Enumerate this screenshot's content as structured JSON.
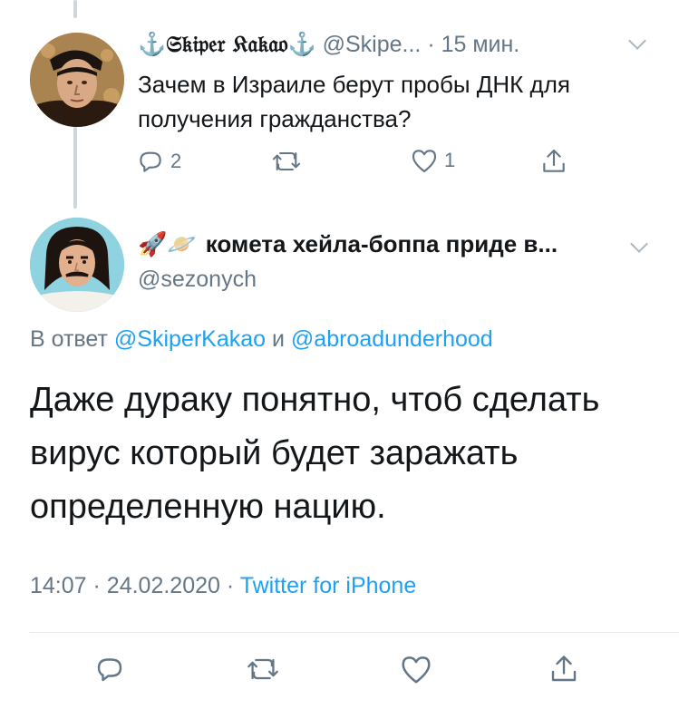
{
  "tweet1": {
    "display_name": "⚓𝔖𝔨𝔦𝔭𝔢𝔯 𝔎𝔞𝔨𝔞𝔬⚓",
    "handle": "@Skipe...",
    "separator": "·",
    "time": "15 мин.",
    "text": "Зачем в Израиле берут пробы ДНК для получения гражданства?",
    "actions": {
      "reply_count": "2",
      "retweet_count": "",
      "like_count": "1"
    },
    "avatar_icon": "man-portrait-painting-avatar"
  },
  "tweet2": {
    "emoji": "🚀🪐",
    "display_name": "комета хейла-боппа приде в...",
    "handle": "@sezonych",
    "reply_prefix": "В ответ",
    "reply_user1": "@SkiperKakao",
    "reply_and": "и",
    "reply_user2": "@abroadunderhood",
    "text": "Даже дураку понятно, чтоб сделать вирус который будет заражать определенную нацию.",
    "time": "14:07",
    "sep": "·",
    "date": "24.02.2020",
    "client": "Twitter for iPhone",
    "avatar_icon": "mustache-man-avatar"
  },
  "colors": {
    "accent": "#1da1f2",
    "secondary_text": "#657786",
    "primary_text": "#14171a",
    "divider": "#e1e8ed",
    "thread_line": "#ccd6dd"
  }
}
